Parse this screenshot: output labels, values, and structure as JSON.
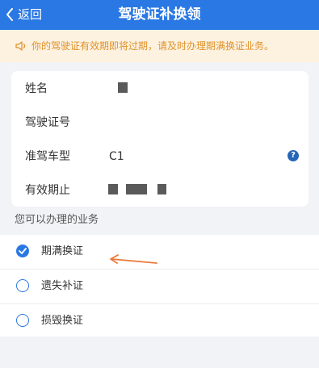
{
  "nav": {
    "back_label": "返回",
    "title": "驾驶证补换领"
  },
  "notice": {
    "icon": "speaker-icon",
    "text": "你的驾驶证有效期即将过期，请及时办理期满换证业务。"
  },
  "license_info": {
    "name_label": "姓名",
    "license_no_label": "驾驶证号",
    "vehicle_type_label": "准驾车型",
    "vehicle_type_value": "C1",
    "help_icon": "question-icon",
    "help_glyph": "?",
    "valid_until_label": "有效期止"
  },
  "services": {
    "section_title": "您可以办理的业务",
    "options": [
      {
        "label": "期满换证",
        "selected": true
      },
      {
        "label": "遗失补证",
        "selected": false
      },
      {
        "label": "损毁换证",
        "selected": false
      }
    ]
  },
  "colors": {
    "primary": "#2a78e4",
    "notice_bg": "#fdf2e0",
    "notice_text": "#e0922a",
    "annotation_arrow": "#e8783a"
  }
}
